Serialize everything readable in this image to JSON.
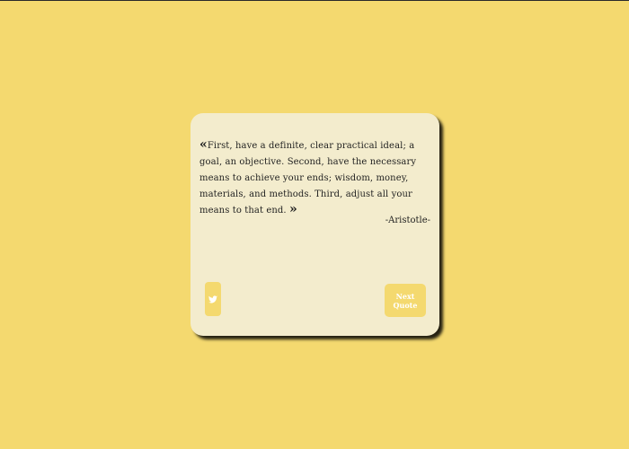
{
  "quote": {
    "open_mark": "«",
    "text": "First, have a definite, clear practical ideal; a goal, an objective. Second, have the necessary means to achieve your ends; wisdom, money, materials, and methods. Third, adjust all your means to that end.",
    "close_mark": "»",
    "author": "-Aristotle-"
  },
  "buttons": {
    "tweet_icon": "twitter-icon",
    "next_label": "Next Quote"
  },
  "colors": {
    "background": "#f4d96f",
    "card": "#f3eccd",
    "button": "#f4d96f",
    "button_text": "#ffffff"
  }
}
